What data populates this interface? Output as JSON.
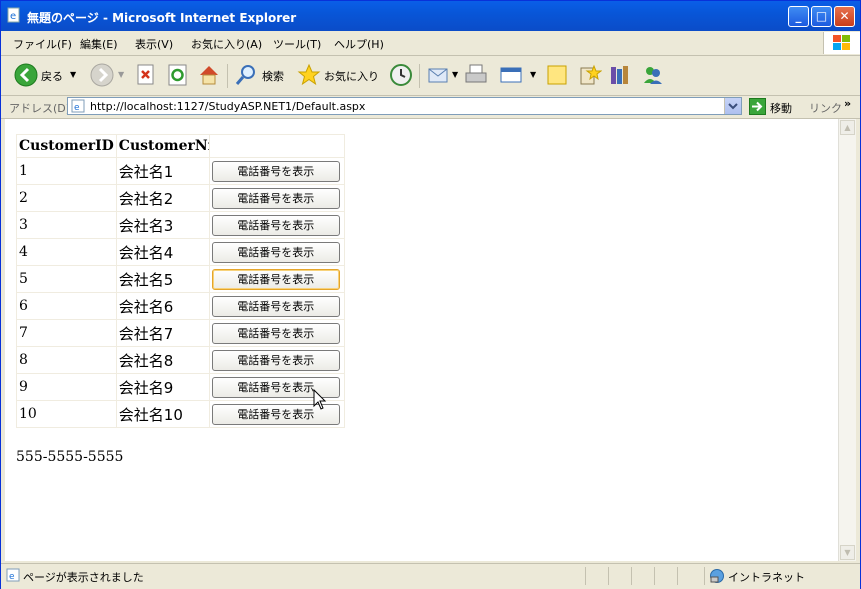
{
  "window": {
    "title": "無題のページ - Microsoft Internet Explorer"
  },
  "menu": [
    "ファイル(F)",
    "編集(E)",
    "表示(V)",
    "お気に入り(A)",
    "ツール(T)",
    "ヘルプ(H)"
  ],
  "toolbar": {
    "back_label": "戻る",
    "search_label": "検索",
    "favorites_label": "お気に入り"
  },
  "address": {
    "label": "アドレス(D)",
    "url": "http://localhost:1127/StudyASP.NET1/Default.aspx",
    "go_label": "移動",
    "links_label": "リンク"
  },
  "table": {
    "headers": [
      "CustomerID",
      "CustomerNm",
      ""
    ],
    "button_label": "電話番号を表示",
    "rows": [
      {
        "id": "1",
        "name": "会社名1"
      },
      {
        "id": "2",
        "name": "会社名2"
      },
      {
        "id": "3",
        "name": "会社名3"
      },
      {
        "id": "4",
        "name": "会社名4"
      },
      {
        "id": "5",
        "name": "会社名5"
      },
      {
        "id": "6",
        "name": "会社名6"
      },
      {
        "id": "7",
        "name": "会社名7"
      },
      {
        "id": "8",
        "name": "会社名8"
      },
      {
        "id": "9",
        "name": "会社名9"
      },
      {
        "id": "10",
        "name": "会社名10"
      }
    ],
    "hovered_row": 5
  },
  "phone_result": "555-5555-5555",
  "status": {
    "text": "ページが表示されました",
    "zone": "イントラネット"
  },
  "colors": {
    "titlebar": "#0a5ee8",
    "chrome": "#ece9d8",
    "button_hover_border": "#e5a52a"
  }
}
